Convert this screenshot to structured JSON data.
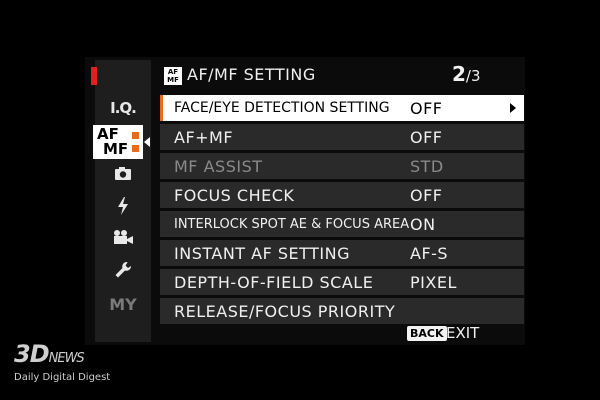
{
  "sidebar": {
    "items": [
      {
        "label": "I.Q.",
        "icon": "iq-icon"
      },
      {
        "label": "AF MF",
        "icon": "af-mf-icon"
      },
      {
        "label": "",
        "icon": "camera-icon"
      },
      {
        "label": "",
        "icon": "flash-icon"
      },
      {
        "label": "",
        "icon": "movie-camera-icon"
      },
      {
        "label": "",
        "icon": "wrench-icon"
      },
      {
        "label": "MY",
        "icon": "my-menu-icon"
      }
    ],
    "af_tab": {
      "line1": "AF",
      "line2": "MF"
    }
  },
  "header": {
    "icon_text": {
      "line1": "AF",
      "line2": "MF"
    },
    "title": "AF/MF SETTING",
    "page_current": "2",
    "page_total": "/3"
  },
  "menu": {
    "rows": [
      {
        "label": "FACE/EYE DETECTION SETTING",
        "value": "OFF",
        "selected": true
      },
      {
        "label": "AF+MF",
        "value": "OFF"
      },
      {
        "label": "MF ASSIST",
        "value": "STD",
        "disabled": true
      },
      {
        "label": "FOCUS CHECK",
        "value": "OFF"
      },
      {
        "label": "INTERLOCK SPOT AE & FOCUS AREA",
        "value": "ON"
      },
      {
        "label": "INSTANT AF SETTING",
        "value": "AF-S"
      },
      {
        "label": "DEPTH-OF-FIELD SCALE",
        "value": "PIXEL"
      },
      {
        "label": "RELEASE/FOCUS PRIORITY",
        "value": ""
      }
    ]
  },
  "footer": {
    "back_key": "BACK",
    "exit_label": "EXIT"
  },
  "watermark": {
    "logo": "3D",
    "logo_suffix": "NEWS",
    "tagline": "Daily Digital Digest"
  },
  "colors": {
    "accent": "#e86a1a",
    "tab_marker": "#e0201e",
    "row_bg": "#2a2a2a"
  }
}
